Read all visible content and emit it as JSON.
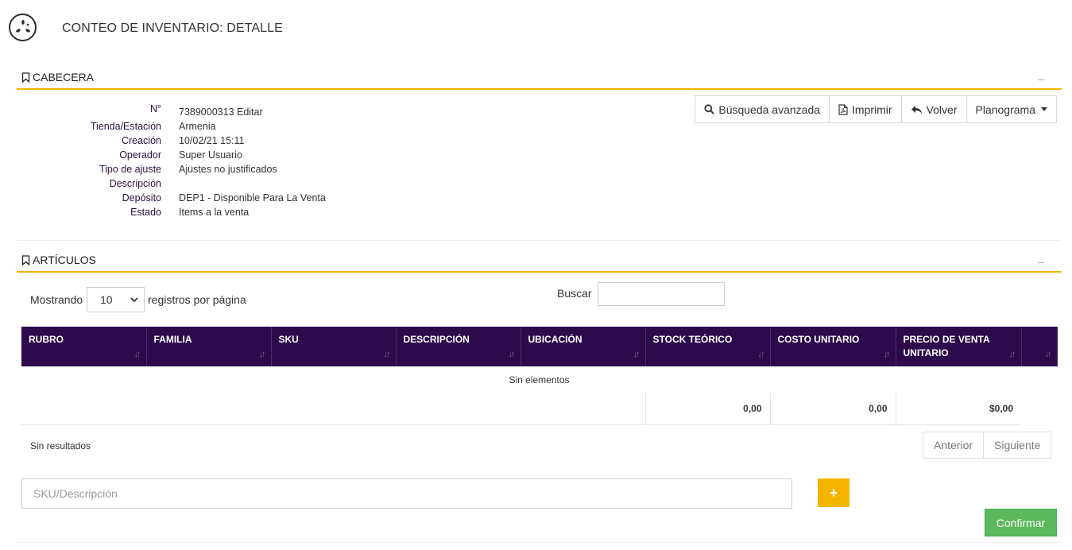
{
  "header": {
    "logo_icon": "star-burst-logo-icon",
    "title": "CONTEO DE INVENTARIO: DETALLE"
  },
  "cabecera": {
    "title": "CABECERA",
    "collapse": "_",
    "fields": [
      {
        "label": "N°",
        "value": "7389000313",
        "link": "Editar"
      },
      {
        "label": "Tienda/Estación",
        "value": "Armenia"
      },
      {
        "label": "Creación",
        "value": "10/02/21 15:11"
      },
      {
        "label": "Operador",
        "value": "Super Usuario"
      },
      {
        "label": "Tipo de ajuste",
        "value": "Ajustes no justificados"
      },
      {
        "label": "Descripción",
        "value": ""
      },
      {
        "label": "Depósito",
        "value": "DEP1 - Disponible Para La Venta"
      },
      {
        "label": "Estado",
        "value": "Items a la venta"
      }
    ],
    "buttons": {
      "search": "Búsqueda avanzada",
      "print": "Imprimir",
      "back": "Volver",
      "planogram": "Planograma"
    }
  },
  "articulos": {
    "title": "ARTÍCULOS",
    "collapse": "_",
    "length": {
      "prefix": "Mostrando",
      "value": "10",
      "suffix": "registros por página"
    },
    "search_label": "Buscar",
    "search_value": "",
    "columns": [
      "RUBRO",
      "FAMILIA",
      "SKU",
      "DESCRIPCIÓN",
      "UBICACIÓN",
      "STOCK TEÓRICO",
      "COSTO UNITARIO",
      "PRECIO DE VENTA UNITARIO",
      ""
    ],
    "empty_text": "Sin elementos",
    "totals": {
      "stock": "0,00",
      "costo": "0,00",
      "precio": "$0,00"
    },
    "results_text": "Sin resultados",
    "pager": {
      "prev": "Anterior",
      "next": "Siguiente"
    },
    "sku_placeholder": "SKU/Descripción",
    "add_label": "+",
    "confirm_label": "Confirmar"
  },
  "colors": {
    "accent": "#f4b400",
    "table_header": "#2d0a4c",
    "confirm": "#5cb85c"
  }
}
